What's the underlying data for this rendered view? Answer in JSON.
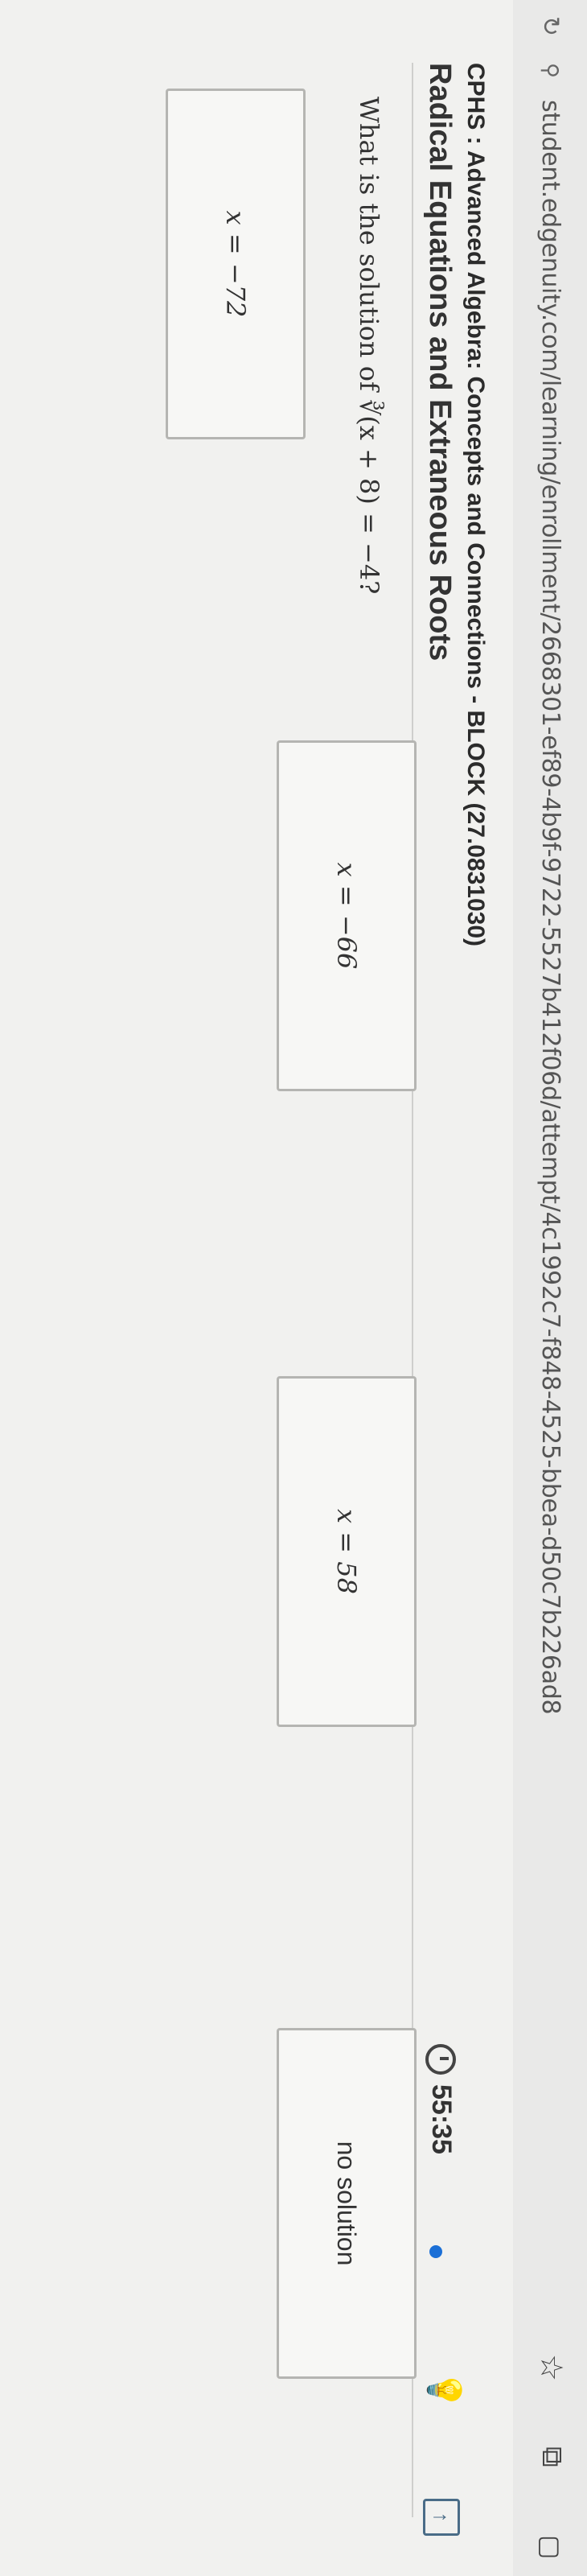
{
  "browser": {
    "url": "student.edgenuity.com/learning/enrollment/2668301-ef89-4b9f-9722-5527b412f06d/attempt/4c1992c7-f848-4525-bbea-d50c7b226ad8"
  },
  "header": {
    "course_title": "CPHS : Advanced Algebra: Concepts and Connections - BLOCK (27.0831030)",
    "lesson_title": "Radical Equations and Extraneous Roots",
    "timer": "55:35"
  },
  "question": {
    "prompt": "What is the solution of ∛(x + 8) = −4?"
  },
  "answers": [
    {
      "label": "x = −72"
    },
    {
      "label": "x = −66"
    },
    {
      "label": "x = 58"
    },
    {
      "label": "no solution"
    }
  ],
  "icons": {
    "reload": "reload-icon",
    "site": "site-settings-icon",
    "bookmark": "star-icon",
    "extension": "extension-icon",
    "account": "profile-icon",
    "hint": "lightbulb-icon",
    "expand": "expand-icon"
  }
}
